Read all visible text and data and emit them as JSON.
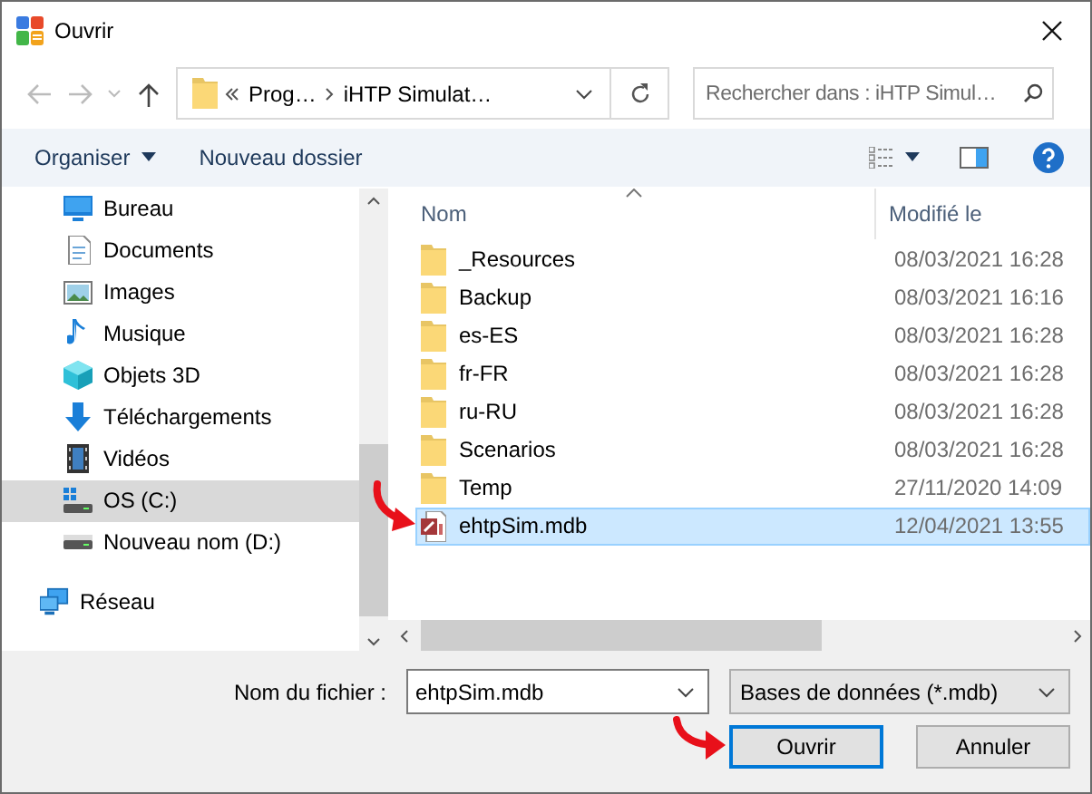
{
  "window": {
    "title": "Ouvrir"
  },
  "address_bar": {
    "segments": [
      "Prog…",
      "iHTP Simulat…"
    ]
  },
  "search": {
    "placeholder": "Rechercher dans : iHTP Simul…"
  },
  "toolbar": {
    "organize": "Organiser",
    "new_folder": "Nouveau dossier"
  },
  "sidebar": {
    "items": [
      {
        "label": "Bureau",
        "kind": "desktop",
        "selected": false
      },
      {
        "label": "Documents",
        "kind": "documents",
        "selected": false
      },
      {
        "label": "Images",
        "kind": "images",
        "selected": false
      },
      {
        "label": "Musique",
        "kind": "music",
        "selected": false
      },
      {
        "label": "Objets 3D",
        "kind": "objects3d",
        "selected": false
      },
      {
        "label": "Téléchargements",
        "kind": "downloads",
        "selected": false
      },
      {
        "label": "Vidéos",
        "kind": "videos",
        "selected": false
      },
      {
        "label": "OS (C:)",
        "kind": "system-drive",
        "selected": true
      },
      {
        "label": "Nouveau nom (D:)",
        "kind": "drive",
        "selected": false
      },
      {
        "label": "Réseau",
        "kind": "network",
        "selected": false
      }
    ]
  },
  "file_list": {
    "columns": [
      "Nom",
      "Modifié le"
    ],
    "rows": [
      {
        "name": "_Resources",
        "modified": "08/03/2021 16:28",
        "kind": "folder",
        "selected": false
      },
      {
        "name": "Backup",
        "modified": "08/03/2021 16:16",
        "kind": "folder",
        "selected": false
      },
      {
        "name": "es-ES",
        "modified": "08/03/2021 16:28",
        "kind": "folder",
        "selected": false
      },
      {
        "name": "fr-FR",
        "modified": "08/03/2021 16:28",
        "kind": "folder",
        "selected": false
      },
      {
        "name": "ru-RU",
        "modified": "08/03/2021 16:28",
        "kind": "folder",
        "selected": false
      },
      {
        "name": "Scenarios",
        "modified": "08/03/2021 16:28",
        "kind": "folder",
        "selected": false
      },
      {
        "name": "Temp",
        "modified": "27/11/2020 14:09",
        "kind": "folder",
        "selected": false
      },
      {
        "name": "ehtpSim.mdb",
        "modified": "12/04/2021 13:55",
        "kind": "database",
        "selected": true
      }
    ]
  },
  "footer": {
    "filename_label": "Nom du fichier :",
    "filename": "ehtpSim.mdb",
    "filter": "Bases de données (*.mdb)",
    "buttons": [
      {
        "label": "Ouvrir",
        "default": true
      },
      {
        "label": "Annuler",
        "default": false
      }
    ]
  }
}
